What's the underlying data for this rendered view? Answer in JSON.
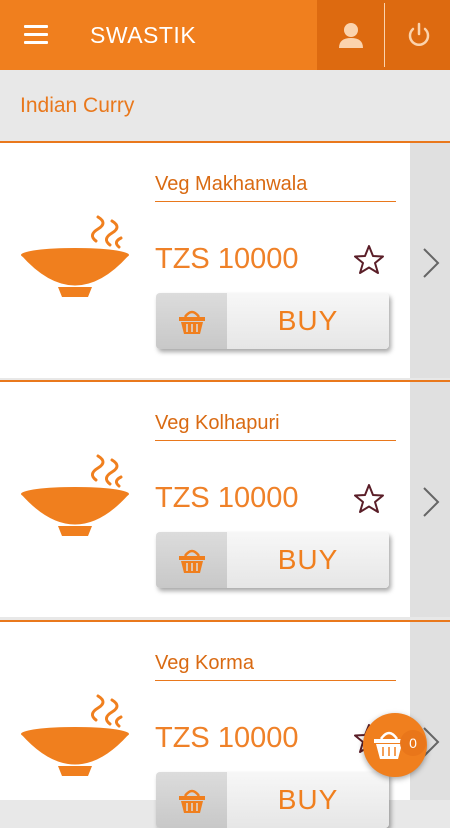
{
  "app": {
    "title": "SWASTIK"
  },
  "icons": {
    "menu": "hamburger-icon",
    "profile": "user-icon",
    "power": "power-icon",
    "dish": "bowl-icon",
    "favorite": "star-outline-icon",
    "basket": "basket-icon",
    "next": "chevron-right-icon",
    "cart": "cart-icon"
  },
  "colors": {
    "primary": "#f07f1e",
    "primary_dark": "#dd6a10",
    "star": "#5a1e28"
  },
  "section": {
    "title": "Indian Curry"
  },
  "products": [
    {
      "name": "Veg Makhanwala",
      "price": "TZS 10000",
      "buy_label": "BUY"
    },
    {
      "name": "Veg Kolhapuri",
      "price": "TZS 10000",
      "buy_label": "BUY"
    },
    {
      "name": "Veg Korma",
      "price": "TZS 10000",
      "buy_label": "BUY"
    }
  ],
  "cart": {
    "count": "0"
  }
}
